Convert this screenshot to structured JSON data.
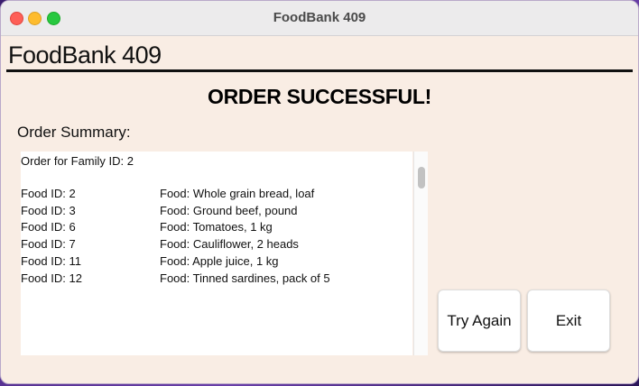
{
  "window": {
    "title": "FoodBank 409"
  },
  "app": {
    "title": "FoodBank 409"
  },
  "headline": "ORDER SUCCESSFUL!",
  "summary_label": "Order Summary:",
  "order": {
    "header": "Order for Family ID: 2",
    "items": [
      {
        "id": "Food ID: 2",
        "food": "Food: Whole grain bread, loaf"
      },
      {
        "id": "Food ID: 3",
        "food": "Food: Ground beef, pound"
      },
      {
        "id": "Food ID: 6",
        "food": "Food: Tomatoes, 1 kg"
      },
      {
        "id": "Food ID: 7",
        "food": "Food: Cauliflower, 2 heads"
      },
      {
        "id": "Food ID: 11",
        "food": "Food: Apple juice, 1 kg"
      },
      {
        "id": "Food ID: 12",
        "food": "Food: Tinned sardines, pack of 5"
      }
    ]
  },
  "buttons": {
    "try_again": "Try Again",
    "exit": "Exit"
  }
}
